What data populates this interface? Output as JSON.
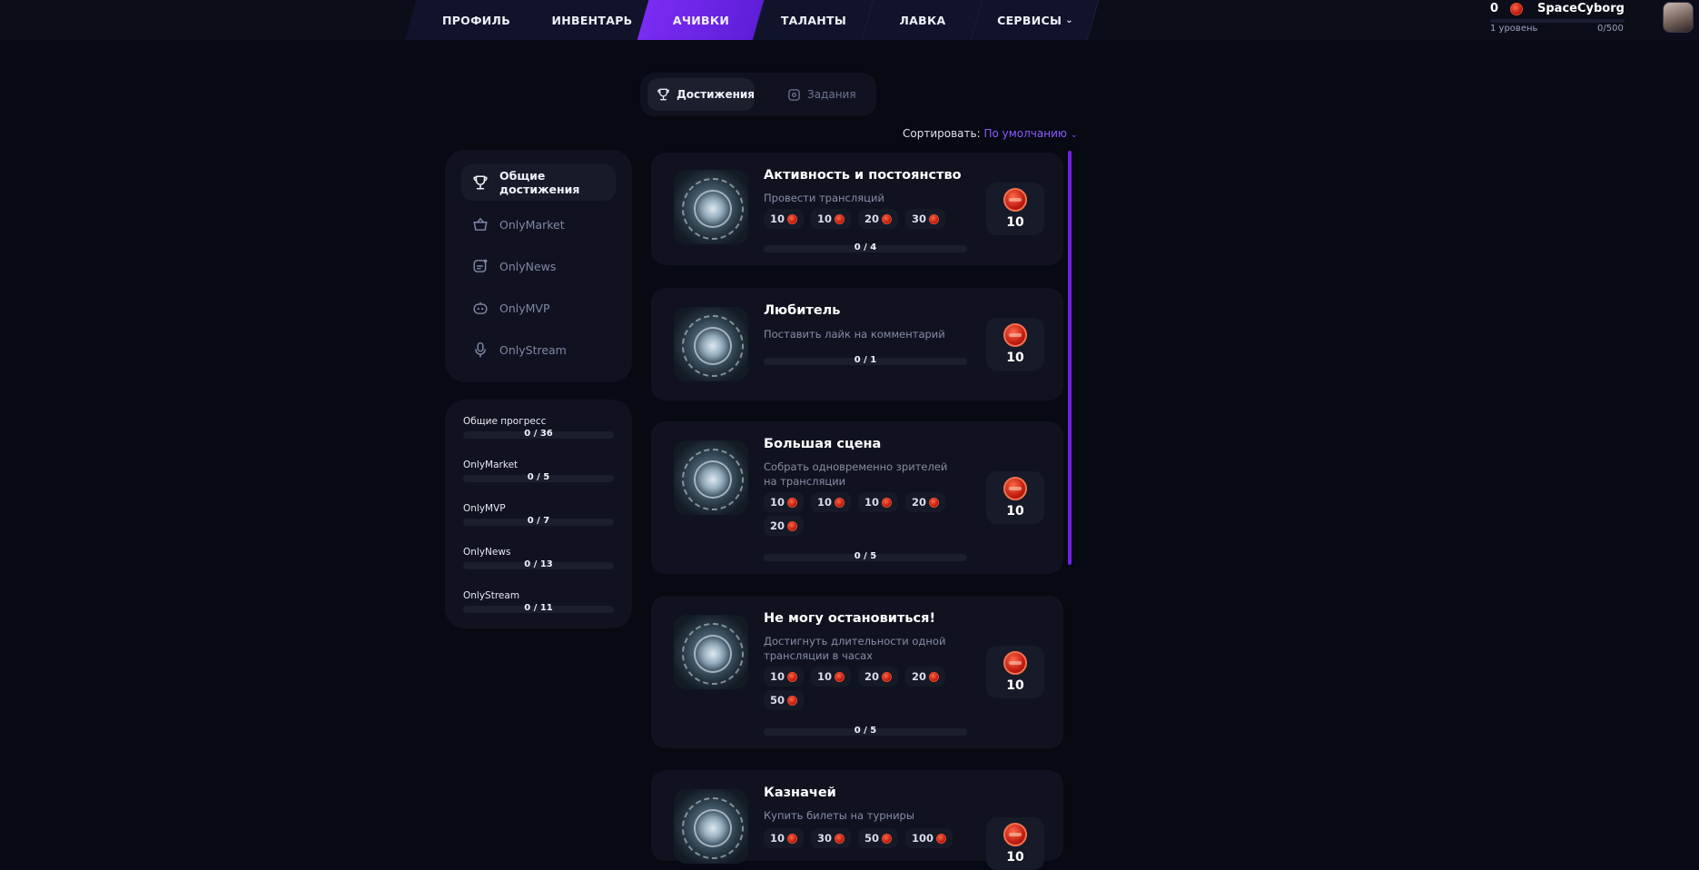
{
  "nav": {
    "tabs": [
      "ПРОФИЛЬ",
      "ИНВЕНТАРЬ",
      "АЧИВКИ",
      "ТАЛАНТЫ",
      "ЛАВКА",
      "СЕРВИСЫ"
    ],
    "active": "АЧИВКИ"
  },
  "user": {
    "coins": "0",
    "name": "SpaceCyborg",
    "level": "1 уровень",
    "xp": "0/500",
    "xp_progress": 0
  },
  "tabs": {
    "achievements": "Достижения",
    "tasks": "Задания"
  },
  "sort": {
    "label": "Сортировать:",
    "value": "По умолчанию"
  },
  "categories": [
    {
      "label": "Общие достижения",
      "icon": "trophy-icon"
    },
    {
      "label": "OnlyMarket",
      "icon": "basket-icon"
    },
    {
      "label": "OnlyNews",
      "icon": "news-icon"
    },
    {
      "label": "OnlyMVP",
      "icon": "gamepad-icon"
    },
    {
      "label": "OnlyStream",
      "icon": "microphone-icon"
    }
  ],
  "progress": [
    {
      "label": "Общие прогресс",
      "value": "0 / 36"
    },
    {
      "label": "OnlyMarket",
      "value": "0 / 5"
    },
    {
      "label": "OnlyMVP",
      "value": "0 / 7"
    },
    {
      "label": "OnlyNews",
      "value": "0 / 13"
    },
    {
      "label": "OnlyStream",
      "value": "0 / 11"
    }
  ],
  "achievements": [
    {
      "title": "Активность и постоянство",
      "desc": "Провести трансляций",
      "tiers": [
        "10",
        "10",
        "20",
        "30"
      ],
      "progress": "0 / 4",
      "reward": "10"
    },
    {
      "title": "Любитель",
      "desc": "Поставить лайк на комментарий",
      "tiers": [],
      "progress": "0 / 1",
      "reward": "10"
    },
    {
      "title": "Большая сцена",
      "desc": "Собрать одновременно зрителей на трансляции",
      "tiers": [
        "10",
        "10",
        "10",
        "20",
        "20"
      ],
      "progress": "0 / 5",
      "reward": "10"
    },
    {
      "title": "Не могу остановиться!",
      "desc": "Достигнуть длительности одной трансляции в часах",
      "tiers": [
        "10",
        "10",
        "20",
        "20",
        "50"
      ],
      "progress": "0 / 5",
      "reward": "10"
    },
    {
      "title": "Казначей",
      "desc": "Купить билеты на турниры",
      "tiers": [
        "10",
        "30",
        "50",
        "100"
      ],
      "progress": "",
      "reward": "10"
    }
  ],
  "colors": {
    "accent": "#7a2cf3",
    "background": "#070913",
    "panel": "#10131f",
    "coin": "#d8301c"
  }
}
